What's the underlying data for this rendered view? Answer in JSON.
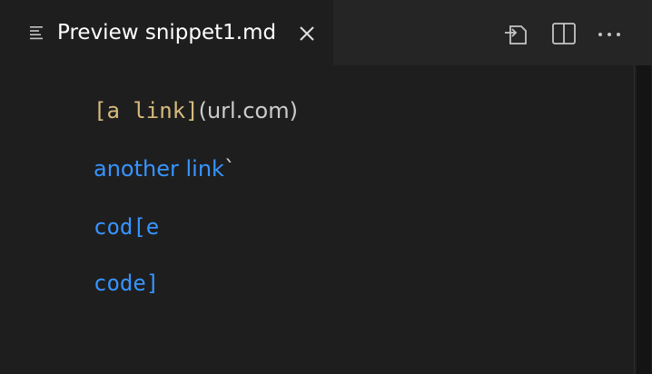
{
  "tab": {
    "title": "Preview snippet1.md",
    "icon": "preview-lines-icon",
    "close_icon": "close-icon"
  },
  "toolbar": {
    "actions": [
      {
        "name": "open-source-icon"
      },
      {
        "name": "split-editor-icon"
      },
      {
        "name": "more-actions-icon"
      }
    ]
  },
  "preview": {
    "line1": {
      "code": "[a link]",
      "text": "(url.com)"
    },
    "line2": {
      "link": "another link",
      "backtick": "`"
    },
    "line3": {
      "code": "cod[e"
    },
    "line4": {
      "code": "code]"
    }
  },
  "colors": {
    "background": "#1e1e1e",
    "tabbar": "#252526",
    "code_tan": "#d7ba7d",
    "link_blue": "#3794ff",
    "text": "#cccccc"
  }
}
